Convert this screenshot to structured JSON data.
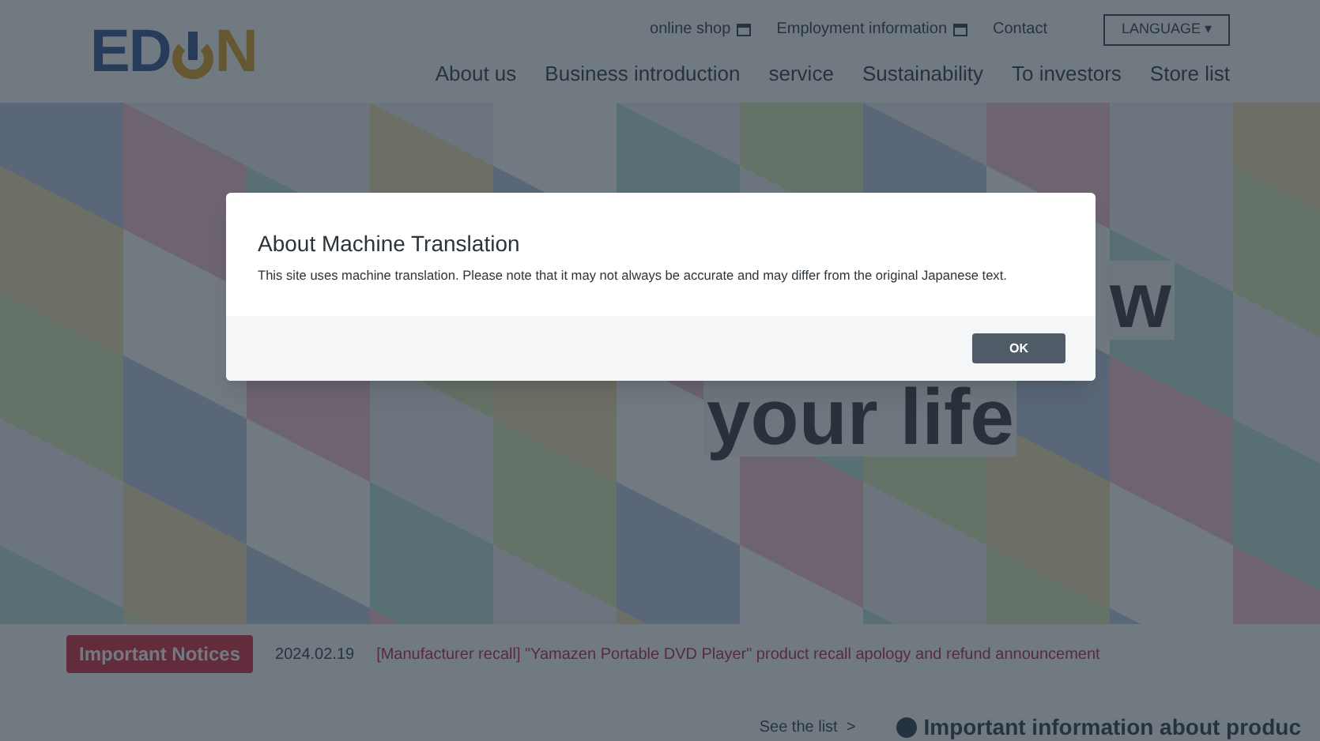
{
  "header": {
    "logo": {
      "left": "ED",
      "right": "N"
    },
    "utility_links": [
      {
        "label": "online shop",
        "external": true
      },
      {
        "label": "Employment information",
        "external": true
      },
      {
        "label": "Contact",
        "external": false
      }
    ],
    "language_button": {
      "label": "LANGUAGE ▾"
    },
    "nav": [
      "About us",
      "Business introduction",
      "service",
      "Sustainability",
      "To investors",
      "Store list"
    ]
  },
  "hero": {
    "text_fragments": [
      "w",
      "your life"
    ]
  },
  "notices": {
    "badge": "Important Notices",
    "date": "2024.02.19",
    "text": "[Manufacturer recall] \"Yamazen Portable DVD Player\" product recall apology and refund announcement"
  },
  "lower": {
    "see_list": "See the list  >",
    "important_heading": "Important information about produc"
  },
  "modal": {
    "title": "About Machine Translation",
    "body": "This site uses machine translation. Please note that it may not always be accurate and may differ from the original Japanese text.",
    "button": "OK"
  }
}
